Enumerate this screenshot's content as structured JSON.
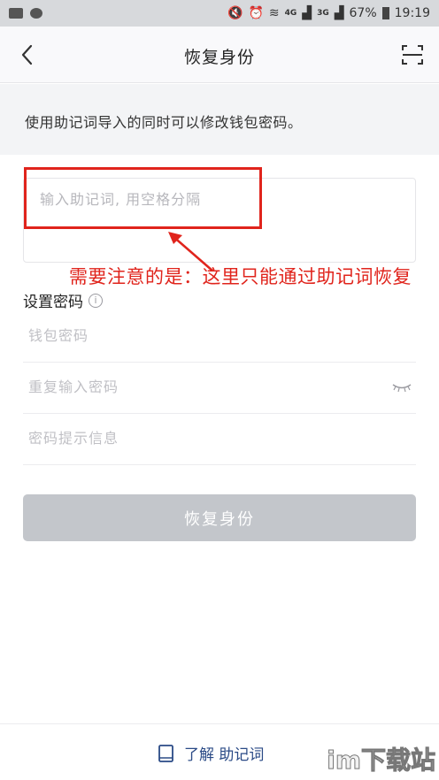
{
  "status_bar": {
    "battery": "67%",
    "time": "19:19",
    "net1": "4G",
    "net2": "3G"
  },
  "header": {
    "title": "恢复身份"
  },
  "description": "使用助记词导入的同时可以修改钱包密码。",
  "mnemonic": {
    "placeholder": "输入助记词, 用空格分隔"
  },
  "annotation": {
    "text": "需要注意的是：这里只能通过助记词恢复",
    "color": "#e0241c"
  },
  "password_section": {
    "label": "设置密码",
    "info_glyph": "i",
    "wallet_password_placeholder": "钱包密码",
    "repeat_password_placeholder": "重复输入密码",
    "hint_placeholder": "密码提示信息"
  },
  "submit_label": "恢复身份",
  "footer": {
    "learn_label": "了解 助记词"
  },
  "watermark": "im下载站",
  "colors": {
    "accent": "#2a4a86",
    "button_disabled": "#c3c6cb",
    "annotation": "#e0241c"
  }
}
